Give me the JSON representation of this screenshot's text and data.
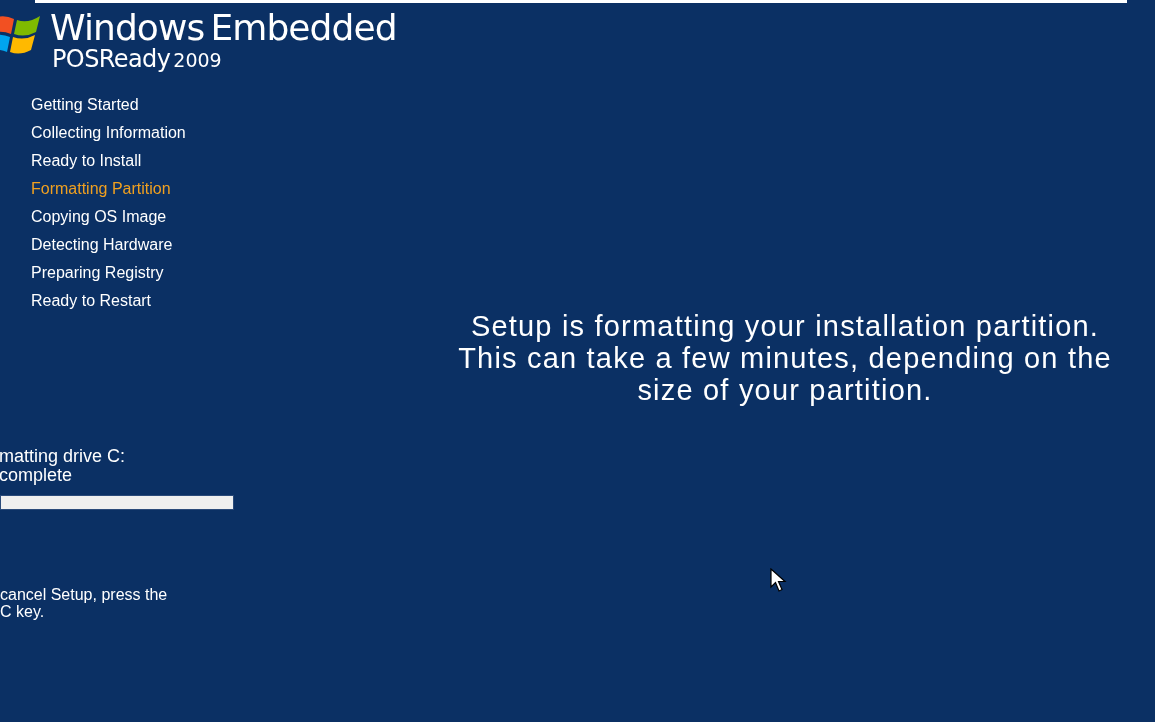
{
  "logo": {
    "brand": "Windows",
    "product": "Embedded",
    "edition": "POSReady",
    "year": "2009"
  },
  "steps": [
    {
      "label": "Getting Started",
      "selected": false
    },
    {
      "label": "Collecting Information",
      "selected": false
    },
    {
      "label": "Ready to Install",
      "selected": false
    },
    {
      "label": "Formatting Partition",
      "selected": true
    },
    {
      "label": "Copying OS Image",
      "selected": false
    },
    {
      "label": "Detecting Hardware",
      "selected": false
    },
    {
      "label": "Preparing Registry",
      "selected": false
    },
    {
      "label": "Ready to Restart",
      "selected": false
    }
  ],
  "status": {
    "lines": [
      "matting drive C:",
      "complete"
    ]
  },
  "cancel_hint": [
    "cancel Setup, press the",
    "C key."
  ],
  "message": "Setup is formatting your installation partition. This can take a few minutes, depending on the size of your partition."
}
